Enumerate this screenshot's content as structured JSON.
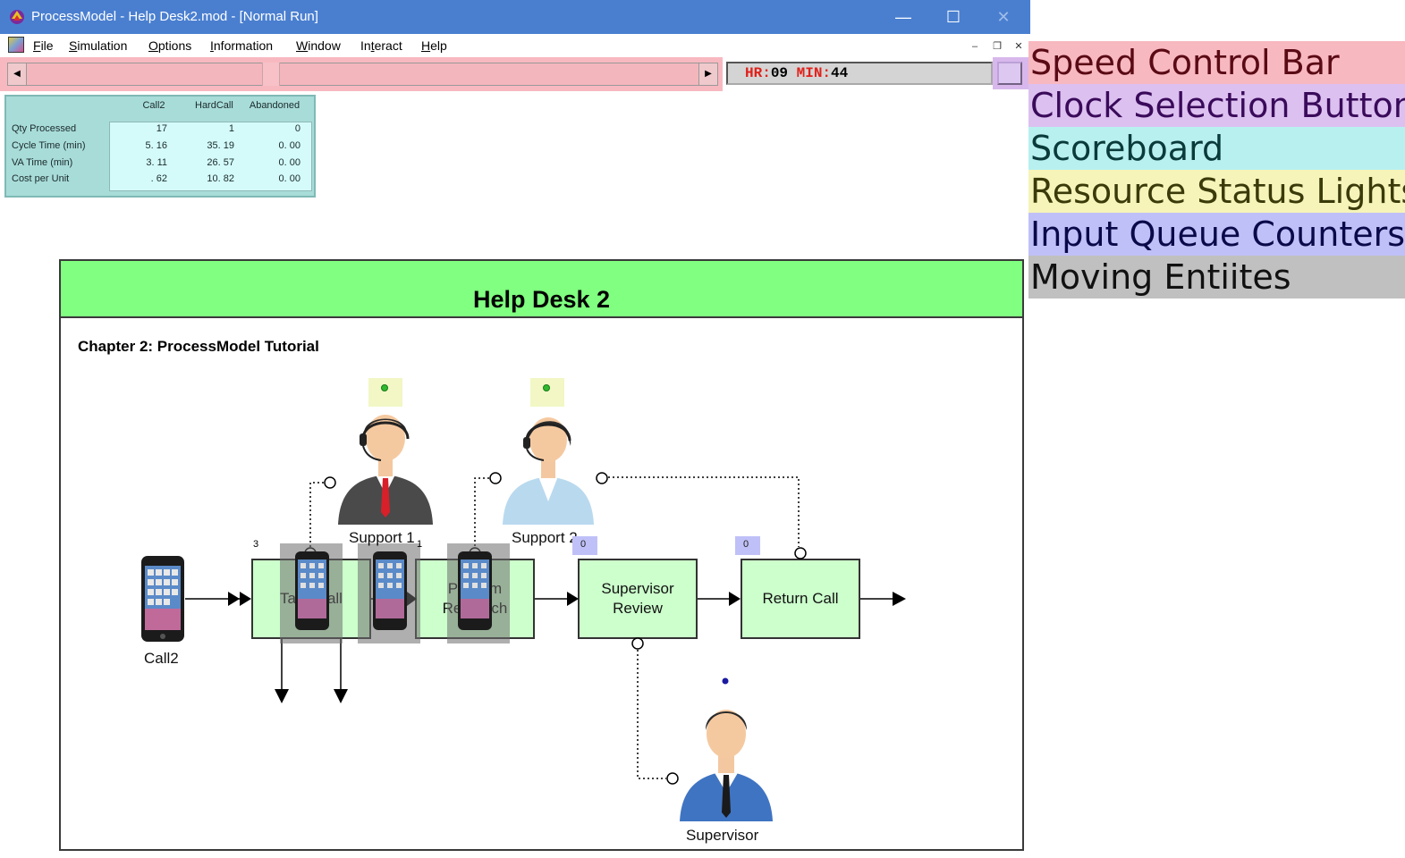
{
  "window": {
    "title": "ProcessModel - Help Desk2.mod - [Normal Run]",
    "controls": {
      "minimize": "—",
      "maximize": "☐",
      "close": "✕"
    }
  },
  "menu": {
    "items": [
      {
        "label": "File",
        "accel": "F"
      },
      {
        "label": "Simulation",
        "accel": "S"
      },
      {
        "label": "Options",
        "accel": "O"
      },
      {
        "label": "Information",
        "accel": "I"
      },
      {
        "label": "Window",
        "accel": "W"
      },
      {
        "label": "Interact",
        "accel": "t"
      },
      {
        "label": "Help",
        "accel": "H"
      }
    ],
    "mdi_controls": {
      "minimize": "–",
      "restore": "❐",
      "close": "✕"
    }
  },
  "speed_bar": {
    "left_arrow": "◀",
    "right_arrow": "▶",
    "position": 0.36
  },
  "clock": {
    "hr_label": "HR:",
    "hr_value": "09",
    "min_label": "MIN:",
    "min_value": "44"
  },
  "scoreboard": {
    "columns": [
      "Call2",
      "HardCall",
      "Abandoned"
    ],
    "rows": [
      {
        "label": "Qty Processed",
        "values": [
          "17",
          "1",
          "0"
        ]
      },
      {
        "label": "Cycle Time (min)",
        "values": [
          "5. 16",
          "35. 19",
          "0. 00"
        ]
      },
      {
        "label": "VA Time (min)",
        "values": [
          "3. 11",
          "26. 57",
          "0. 00"
        ]
      },
      {
        "label": "Cost per Unit",
        "values": [
          ". 62",
          "10. 82",
          "0. 00"
        ]
      }
    ]
  },
  "legend": [
    {
      "label": "Speed Control Bar",
      "bg": "#f8b8c0",
      "fg": "#5a0a14"
    },
    {
      "label": "Clock Selection Button",
      "bg": "#dcc0f0",
      "fg": "#3a0a5a"
    },
    {
      "label": "Scoreboard",
      "bg": "#b8f0f0",
      "fg": "#0a3a3a"
    },
    {
      "label": "Resource Status Lights",
      "bg": "#f6f4b8",
      "fg": "#3a3a0a"
    },
    {
      "label": "Input Queue Counters",
      "bg": "#c0c0f8",
      "fg": "#0a0a4a"
    },
    {
      "label": "Moving Entiites",
      "bg": "#c0c0c0",
      "fg": "#111111"
    }
  ],
  "canvas": {
    "title": "Help Desk 2",
    "subtitle": "Chapter 2: ProcessModel Tutorial",
    "title_band_color": "#80ff80",
    "entity_label": "Call2",
    "resources": [
      "Support 1",
      "Support 2",
      "Supervisor"
    ],
    "activities": [
      {
        "label": "Take Call"
      },
      {
        "label": "Perform Research"
      },
      {
        "label": "Supervisor Review"
      },
      {
        "label": "Return Call"
      }
    ],
    "queue_counters": [
      "0",
      "0"
    ],
    "entity_counts": [
      "3",
      "1"
    ]
  }
}
